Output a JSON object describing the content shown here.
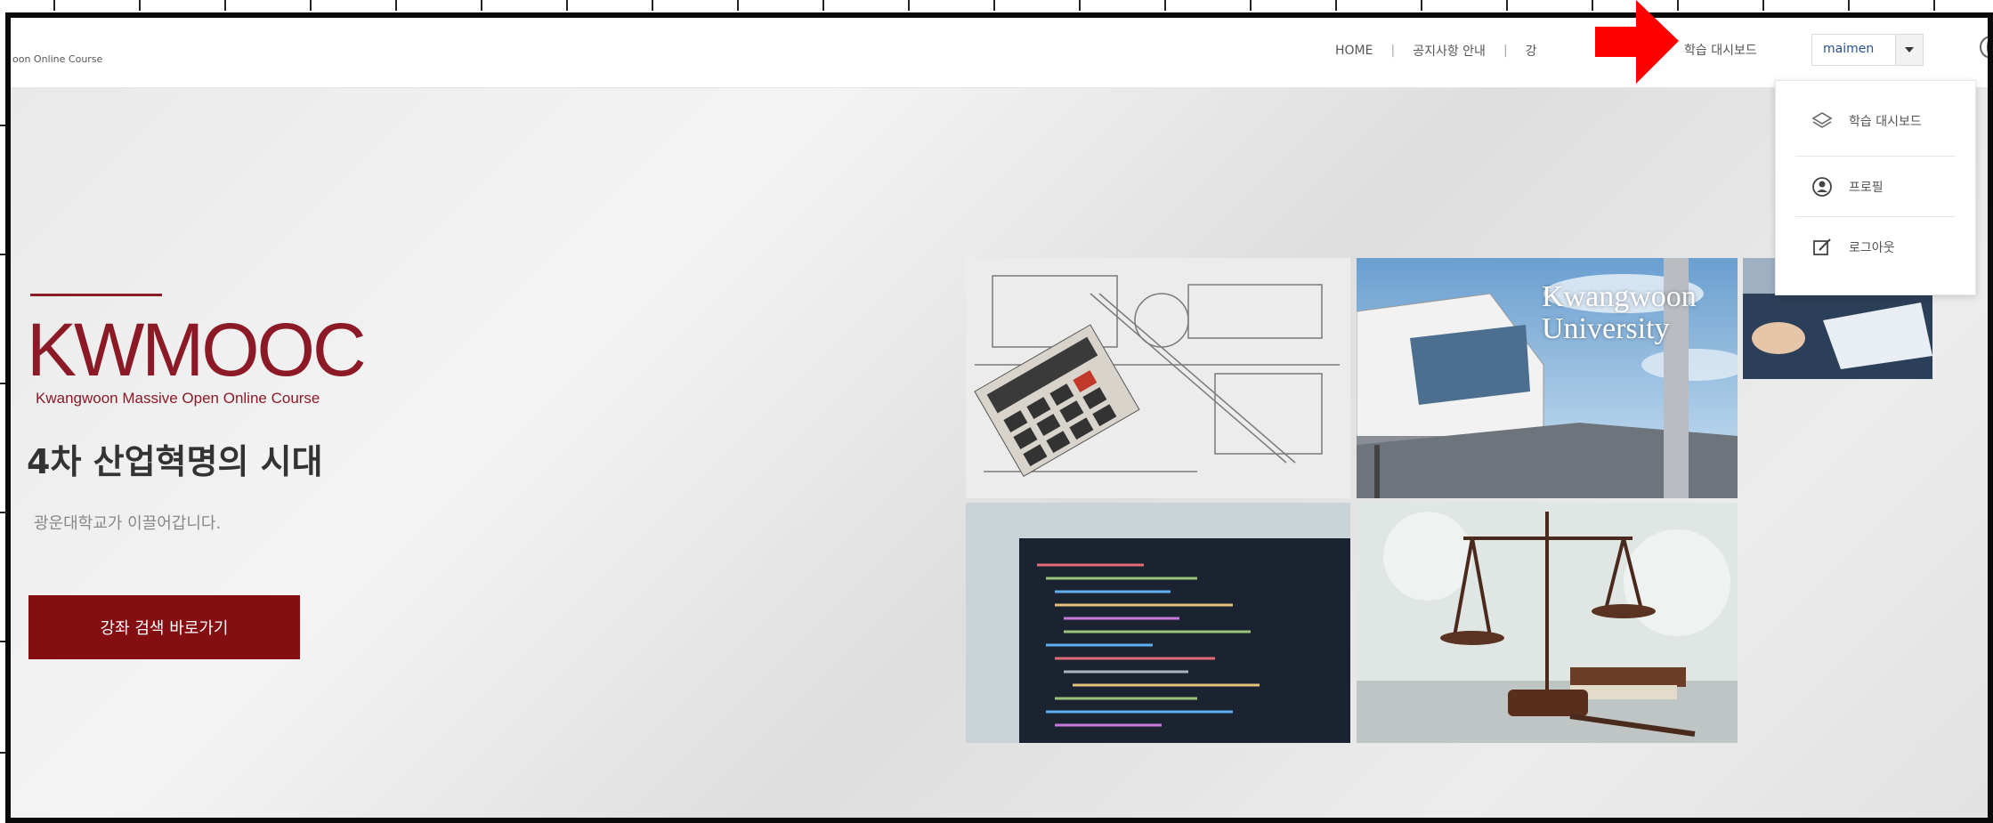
{
  "header": {
    "site_subtitle": "oon Online Course",
    "nav": [
      "HOME",
      "공지사항 안내",
      "강"
    ],
    "separator": "|",
    "dashboard_link": "학습 대시보드",
    "username": "maimen"
  },
  "dropdown": {
    "items": [
      {
        "label": "학습 대시보드",
        "icon": "layers-icon"
      },
      {
        "label": "프로필",
        "icon": "user-circle-icon"
      },
      {
        "label": "로그아웃",
        "icon": "edit-icon"
      }
    ]
  },
  "hero": {
    "logo": "KWMOOC",
    "logo_subtitle": "Kwangwoon Massive Open Online Course",
    "headline": "4차 산업혁명의 시대",
    "tagline": "광운대학교가 이끌어갑니다.",
    "cta_label": "강좌 검색 바로가기",
    "tile_caption_line1": "Kwangwoon",
    "tile_caption_line2": "University"
  },
  "colors": {
    "brand": "#8b1a26",
    "cta": "#850e12",
    "annotation": "#ff0000"
  }
}
